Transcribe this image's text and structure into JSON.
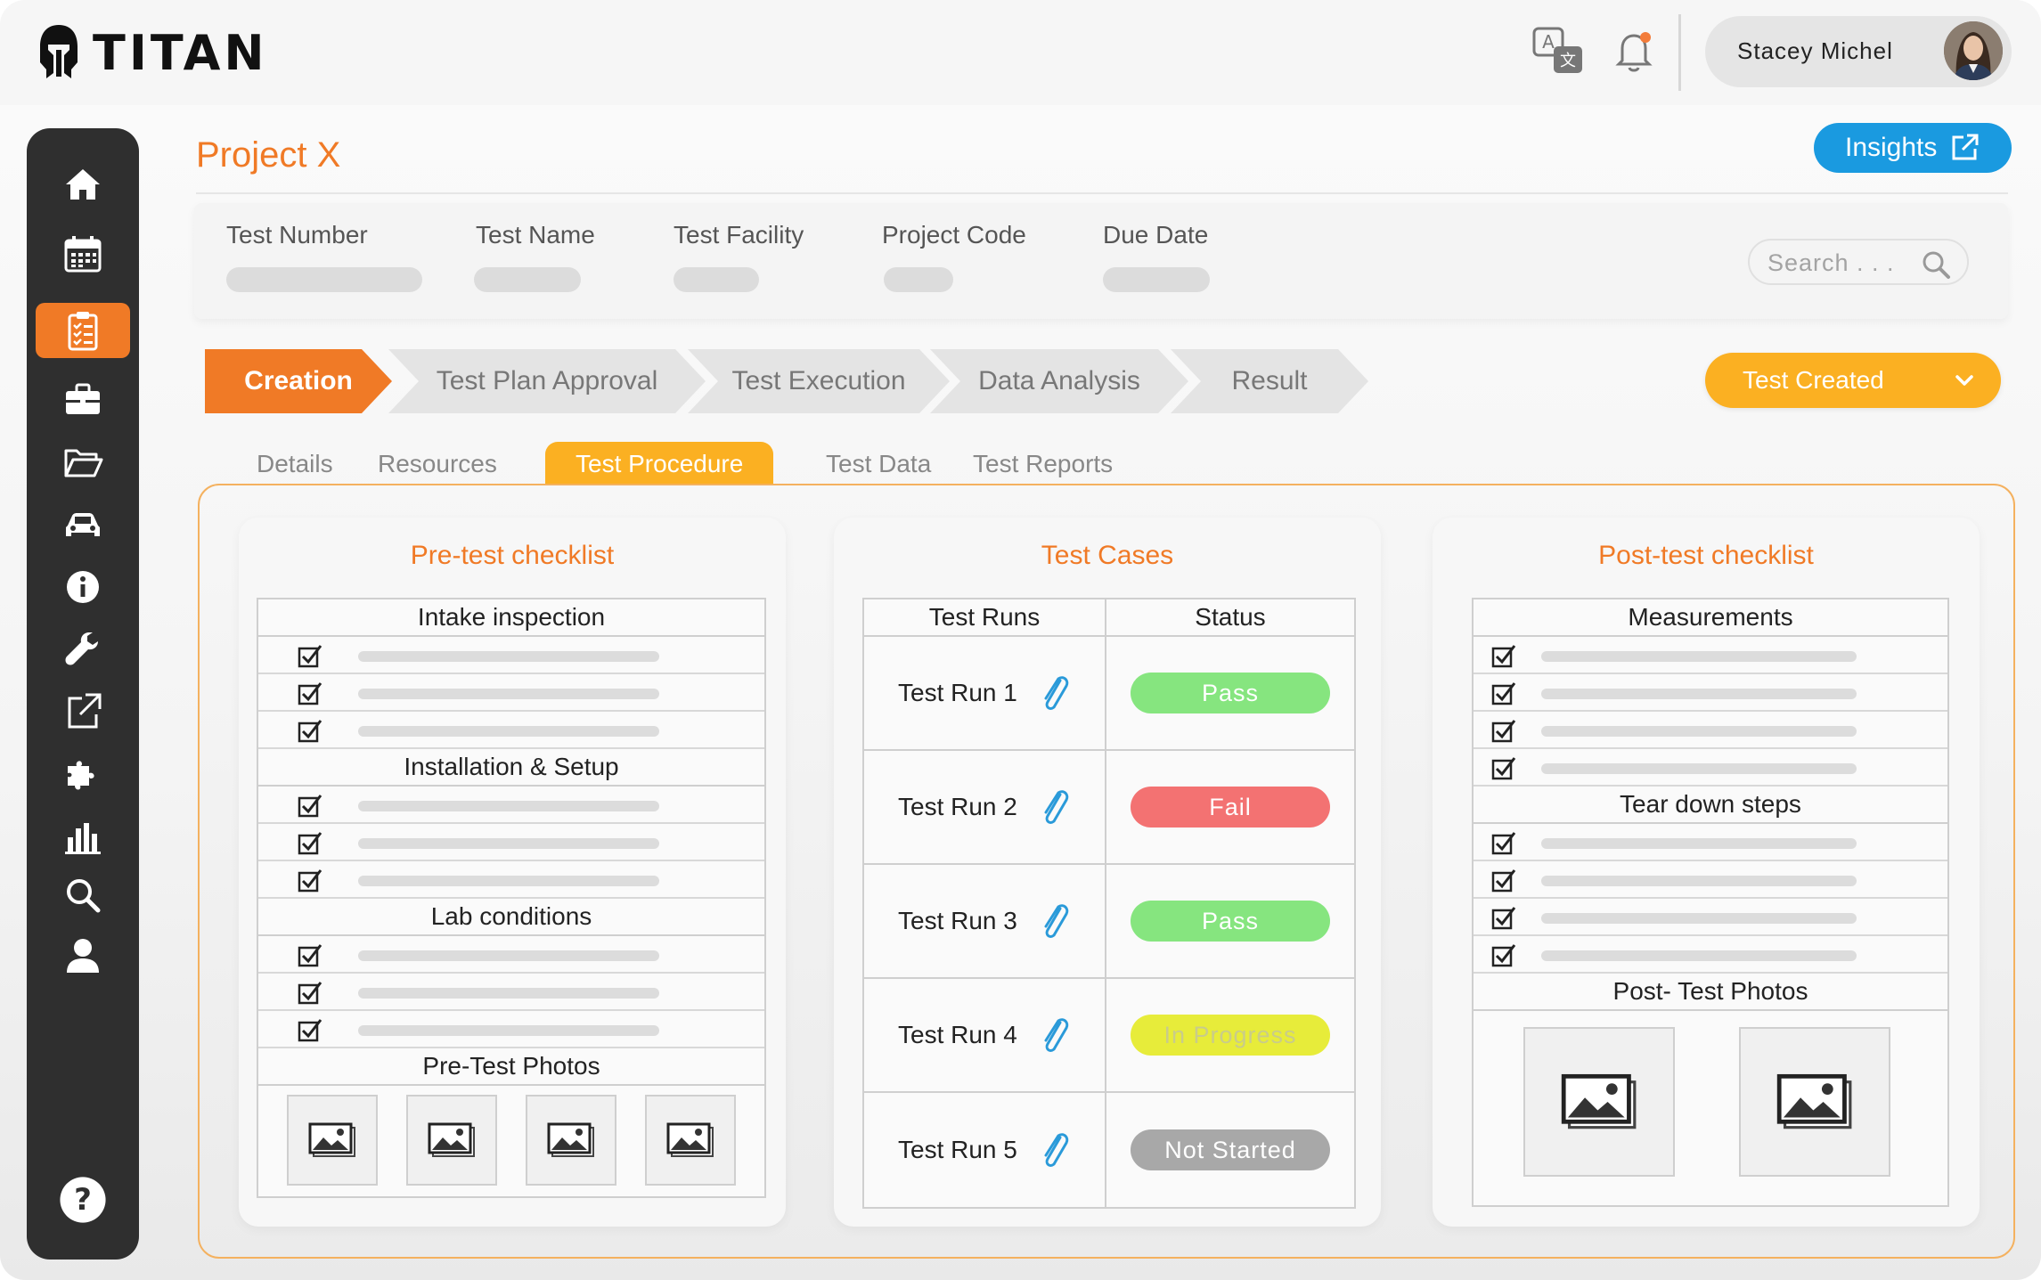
{
  "app": {
    "name": "TITAN"
  },
  "header": {
    "translate_icon": "translate-icon",
    "notification_icon": "bell-icon",
    "user_name": "Stacey Michel"
  },
  "sidebar": {
    "items": [
      {
        "icon": "home-icon",
        "active": false
      },
      {
        "icon": "calendar-icon",
        "active": false
      },
      {
        "icon": "clipboard-checklist-icon",
        "active": true
      },
      {
        "icon": "briefcase-icon",
        "active": false
      },
      {
        "icon": "folder-open-icon",
        "active": false
      },
      {
        "icon": "car-icon",
        "active": false
      },
      {
        "icon": "info-icon",
        "active": false
      },
      {
        "icon": "wrench-icon",
        "active": false
      },
      {
        "icon": "external-link-icon",
        "active": false
      },
      {
        "icon": "puzzle-icon",
        "active": false
      },
      {
        "icon": "bar-chart-icon",
        "active": false
      },
      {
        "icon": "search-icon",
        "active": false
      },
      {
        "icon": "user-icon",
        "active": false
      }
    ],
    "help_icon": "help-icon"
  },
  "page": {
    "title": "Project X",
    "insights_label": "Insights"
  },
  "info": {
    "fields": [
      {
        "label": "Test Number"
      },
      {
        "label": "Test Name"
      },
      {
        "label": "Test Facility"
      },
      {
        "label": "Project Code"
      },
      {
        "label": "Due Date"
      }
    ],
    "search_placeholder": "Search . . ."
  },
  "stepper": {
    "steps": [
      "Creation",
      "Test Plan Approval",
      "Test Execution",
      "Data Analysis",
      "Result"
    ],
    "current": "Creation",
    "status_label": "Test Created"
  },
  "tabs": {
    "items": [
      "Details",
      "Resources",
      "Test Procedure",
      "Test Data",
      "Test Reports"
    ],
    "active": "Test Procedure"
  },
  "pretest": {
    "title": "Pre-test checklist",
    "sections": [
      {
        "name": "Intake inspection",
        "checked": 3
      },
      {
        "name": "Installation & Setup",
        "checked": 3
      },
      {
        "name": "Lab conditions",
        "checked": 3
      }
    ],
    "photos_label": "Pre-Test Photos"
  },
  "testcases": {
    "title": "Test Cases",
    "col_runs": "Test Runs",
    "col_status": "Status",
    "rows": [
      {
        "run": "Test Run 1",
        "status": "Pass",
        "color": "#86e57f"
      },
      {
        "run": "Test Run 2",
        "status": "Fail",
        "color": "#f37272"
      },
      {
        "run": "Test Run 3",
        "status": "Pass",
        "color": "#86e57f"
      },
      {
        "run": "Test Run 4",
        "status": "In Progress",
        "color": "#e7ec3a"
      },
      {
        "run": "Test Run 5",
        "status": "Not Started",
        "color": "#a8a8a8"
      }
    ]
  },
  "posttest": {
    "title": "Post-test checklist",
    "sections": [
      {
        "name": "Measurements",
        "checked": 4
      },
      {
        "name": "Tear down steps",
        "checked": 4
      }
    ],
    "photos_label": "Post- Test Photos"
  },
  "colors": {
    "accent_orange": "#f07a26",
    "accent_yellow": "#fbb022",
    "accent_blue": "#1a9ae0",
    "sidebar": "#2f2f2f"
  }
}
